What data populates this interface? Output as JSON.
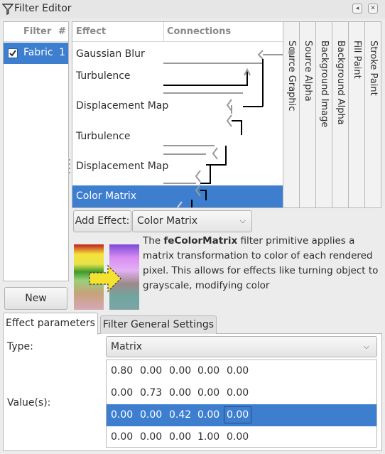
{
  "window": {
    "title": "Filter Editor",
    "buttons": [
      "◂",
      "✕"
    ]
  },
  "filter_list": {
    "columns": [
      "Filter",
      "#"
    ],
    "items": [
      {
        "checked": true,
        "name": "Fabric",
        "count": "1"
      }
    ],
    "new_label": "New"
  },
  "effects": {
    "columns": [
      "Effect",
      "Connections"
    ],
    "items": [
      {
        "label": "Gaussian Blur"
      },
      {
        "label": "Turbulence"
      },
      {
        "label": "Displacement Map"
      },
      {
        "label": "Turbulence"
      },
      {
        "label": "Displacement Map"
      },
      {
        "label": "Color Matrix",
        "selected": true
      }
    ],
    "inputs": [
      "Source Graphic",
      "Source Alpha",
      "Background Image",
      "Background Alpha",
      "Fill Paint",
      "Stroke Paint"
    ]
  },
  "add_effect": {
    "button_label": "Add Effect:",
    "selected_effect": "Color Matrix"
  },
  "description": {
    "prefix": "The ",
    "primitive": "feColorMatrix",
    "body": " filter primitive applies a matrix transformation to color of each rendered pixel. This allows for effects like turning object to grayscale, modifying color"
  },
  "tabs": [
    {
      "label": "Effect parameters",
      "active": true
    },
    {
      "label": "Filter General Settings",
      "active": false
    }
  ],
  "params": {
    "type_label": "Type:",
    "type_value": "Matrix",
    "values_label": "Value(s):",
    "matrix": [
      [
        "0.80",
        "0.00",
        "0.00",
        "0.00",
        "0.00"
      ],
      [
        "0.00",
        "0.73",
        "0.00",
        "0.00",
        "0.00"
      ],
      [
        "0.00",
        "0.00",
        "0.42",
        "0.00",
        "0.00"
      ],
      [
        "0.00",
        "0.00",
        "0.00",
        "1.00",
        "0.00"
      ]
    ],
    "selected_row": 2
  },
  "colors": {
    "selection": "#3d7ecf",
    "connector": "#000000",
    "connector_dim": "#9a9a9a"
  }
}
